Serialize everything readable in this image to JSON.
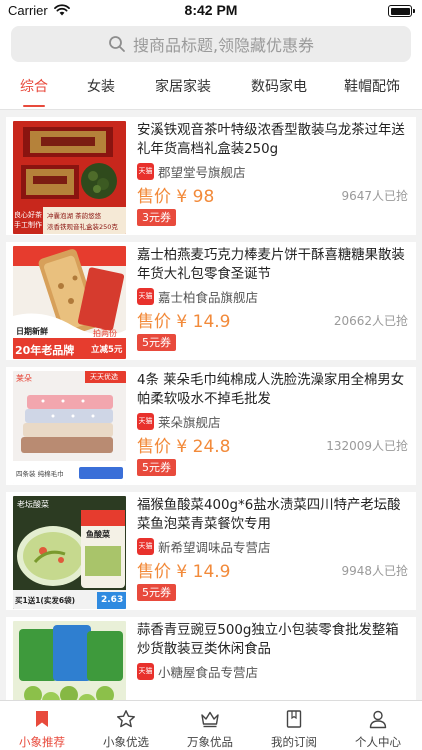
{
  "status_bar": {
    "carrier": "Carrier",
    "time": "8:42 PM",
    "battery_level": 1.0
  },
  "search": {
    "placeholder": "搜商品标题,领隐藏优惠券",
    "icon": "search-icon"
  },
  "categories": [
    {
      "label": "综合",
      "active": true
    },
    {
      "label": "女装",
      "active": false
    },
    {
      "label": "家居家装",
      "active": false
    },
    {
      "label": "数码家电",
      "active": false
    },
    {
      "label": "鞋帽配饰",
      "active": false
    }
  ],
  "tmall_badge": "天猫",
  "products": [
    {
      "title": "安溪铁观音茶叶特级浓香型散装乌龙茶过年送礼年货高档礼盒装250g",
      "shop": "郡望堂号旗舰店",
      "price": "售价 ¥ 98",
      "sold": "9647人已抢",
      "coupon": "3元券",
      "image_texts": [
        "良心好茶",
        "手工制作",
        "冲囊泡湖 茶韵悠悠",
        "浓香铁观音礼盒装250克"
      ]
    },
    {
      "title": "嘉士柏燕麦巧克力棒麦片饼干酥喜糖糖果散装年货大礼包零食圣诞节",
      "shop": "嘉士柏食品旗舰店",
      "price": "售价 ¥ 14.9",
      "sold": "20662人已抢",
      "coupon": "5元券",
      "image_texts": [
        "日期新鲜",
        "20年老品牌",
        "拍两份",
        "立减5元"
      ]
    },
    {
      "title": "4条 莱朵毛巾纯棉成人洗脸洗澡家用全棉男女帕柔软吸水不掉毛批发",
      "shop": "莱朵旗舰店",
      "price": "售价 ¥ 24.8",
      "sold": "132009人已抢",
      "coupon": "5元券",
      "image_texts": [
        "天天优选",
        "莱朵",
        "四条装 纯棉毛巾"
      ]
    },
    {
      "title": "福猴鱼酸菜400g*6盐水渍菜四川特产老坛酸菜鱼泡菜青菜餐饮专用",
      "shop": "新希望调味品专营店",
      "price": "售价 ¥ 14.9",
      "sold": "9948人已抢",
      "coupon": "5元券",
      "image_texts": [
        "老坛酸菜",
        "鱼酸菜",
        "买1送1(实发6袋)",
        "2.63"
      ]
    },
    {
      "title": "蒜香青豆豌豆500g独立小包装零食批发整箱炒货散装豆类休闲食品",
      "shop": "小糖屋食品专营店",
      "price": "",
      "sold": "",
      "coupon": "",
      "image_texts": []
    }
  ],
  "tabbar": [
    {
      "label": "小象推荐",
      "icon": "bookmark-icon",
      "active": true
    },
    {
      "label": "小象优选",
      "icon": "star-icon",
      "active": false
    },
    {
      "label": "万象优品",
      "icon": "crown-icon",
      "active": false
    },
    {
      "label": "我的订阅",
      "icon": "book-icon",
      "active": false
    },
    {
      "label": "个人中心",
      "icon": "person-icon",
      "active": false
    }
  ],
  "colors": {
    "accent": "#e84a3c",
    "price": "#f28a3a",
    "tmall": "#e8312c"
  }
}
